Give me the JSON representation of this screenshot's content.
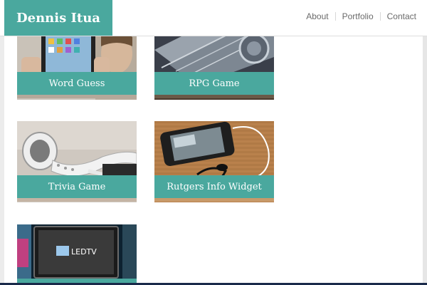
{
  "header": {
    "logo": "Dennis Itua",
    "nav": [
      "About",
      "Portfolio",
      "Contact"
    ]
  },
  "portfolio": {
    "items": [
      {
        "title": "Word Guess",
        "image": "tablet-person-photo"
      },
      {
        "title": "RPG Game",
        "image": "circuit-board-photo"
      },
      {
        "title": "Trivia Game",
        "image": "earbuds-photo"
      },
      {
        "title": "Rutgers Info Widget",
        "image": "smartphone-earphones-photo"
      },
      {
        "title": "",
        "image": "led-tv-photo"
      }
    ],
    "tv_logo_text": "LEDTV"
  },
  "colors": {
    "accent": "#4aa89e",
    "nav_text": "#6a6a6a",
    "label_text": "#ffffff"
  }
}
